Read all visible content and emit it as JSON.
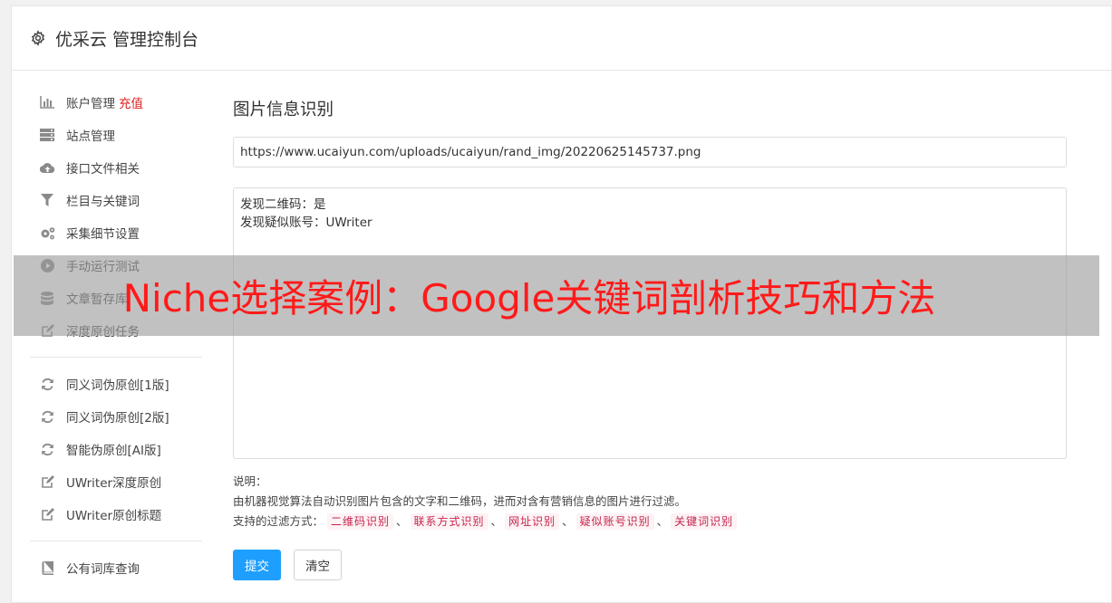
{
  "header": {
    "title": "优采云 管理控制台",
    "icon": "gear-icon"
  },
  "sidebar": {
    "groups": [
      [
        {
          "icon": "bar-chart-icon",
          "label": "账户管理",
          "badge": "充值",
          "badge_color": "#e02020"
        },
        {
          "icon": "server-icon",
          "label": "站点管理"
        },
        {
          "icon": "cloud-upload-icon",
          "label": "接口文件相关"
        },
        {
          "icon": "filter-icon",
          "label": "栏目与关键词"
        },
        {
          "icon": "cogs-icon",
          "label": "采集细节设置"
        },
        {
          "icon": "play-circle-icon",
          "label": "手动运行测试"
        },
        {
          "icon": "database-icon",
          "label": "文章暂存库"
        },
        {
          "icon": "edit-icon",
          "label": "深度原创任务"
        }
      ],
      [
        {
          "icon": "refresh-icon",
          "label": "同义词伪原创[1版]"
        },
        {
          "icon": "refresh-icon",
          "label": "同义词伪原创[2版]"
        },
        {
          "icon": "refresh-icon",
          "label": "智能伪原创[AI版]"
        },
        {
          "icon": "edit-icon",
          "label": "UWriter深度原创"
        },
        {
          "icon": "edit-icon",
          "label": "UWriter原创标题"
        }
      ],
      [
        {
          "icon": "book-icon",
          "label": "公有词库查询"
        }
      ]
    ]
  },
  "main": {
    "section_title": "图片信息识别",
    "url_value": "https://www.ucaiyun.com/uploads/ucaiyun/rand_img/20220625145737.png",
    "result_lines": [
      "发现二维码：是",
      "发现疑似账号：UWriter"
    ],
    "notes_label": "说明：",
    "notes_text": "由机器视觉算法自动识别图片包含的文字和二维码，进而对含有营销信息的图片进行过滤。",
    "filter_label": "支持的过滤方式：",
    "filter_tags": [
      "二维码识别",
      "联系方式识别",
      "网址识别",
      "疑似账号识别",
      "关键词识别"
    ],
    "separator": "、",
    "submit_label": "提交",
    "clear_label": "清空"
  },
  "overlay": {
    "text": "Niche选择案例：Google关键词剖析技巧和方法",
    "color": "#ff1a1a"
  },
  "colors": {
    "primary": "#1e9fff",
    "tag_text": "#c7254e",
    "tag_bg": "#fdf2f4"
  }
}
